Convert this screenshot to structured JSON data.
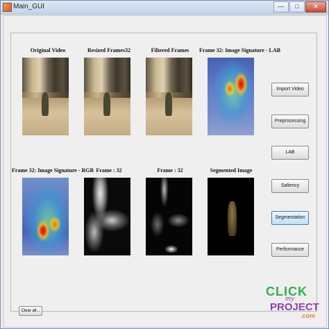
{
  "window": {
    "title": "Main_GUI"
  },
  "panels": {
    "row1": [
      {
        "label": "Original Video",
        "kind": "street"
      },
      {
        "label": "Resized Frames32",
        "kind": "street"
      },
      {
        "label": "Filtered Frames",
        "kind": "street"
      },
      {
        "label": "Frame 32: Image Signature - LAB",
        "kind": "heat"
      }
    ],
    "row2": [
      {
        "label": "Frame 32: Image Signature - RGB",
        "kind": "heat"
      },
      {
        "label": "Frame : 32",
        "kind": "gray"
      },
      {
        "label": "Frame : 32",
        "kind": "gray"
      },
      {
        "label": "Segmented Image",
        "kind": "segmented"
      }
    ]
  },
  "buttons": [
    {
      "label": "Import Video"
    },
    {
      "label": "Preprocessing"
    },
    {
      "label": "LAB"
    },
    {
      "label": "Saliency"
    },
    {
      "label": "Segmentation",
      "state": "focused"
    },
    {
      "label": "Performance"
    }
  ],
  "clear_button": {
    "label": "Clear all..."
  },
  "watermark": {
    "line1": "CLICK",
    "line2": "my",
    "line3": "PROJECT",
    "line4": ".com"
  },
  "colors": {
    "accent": "#3c7fb1",
    "watermark_green": "#2fb24d",
    "watermark_purple": "#8d3fb5",
    "watermark_orange": "#e0862c"
  }
}
